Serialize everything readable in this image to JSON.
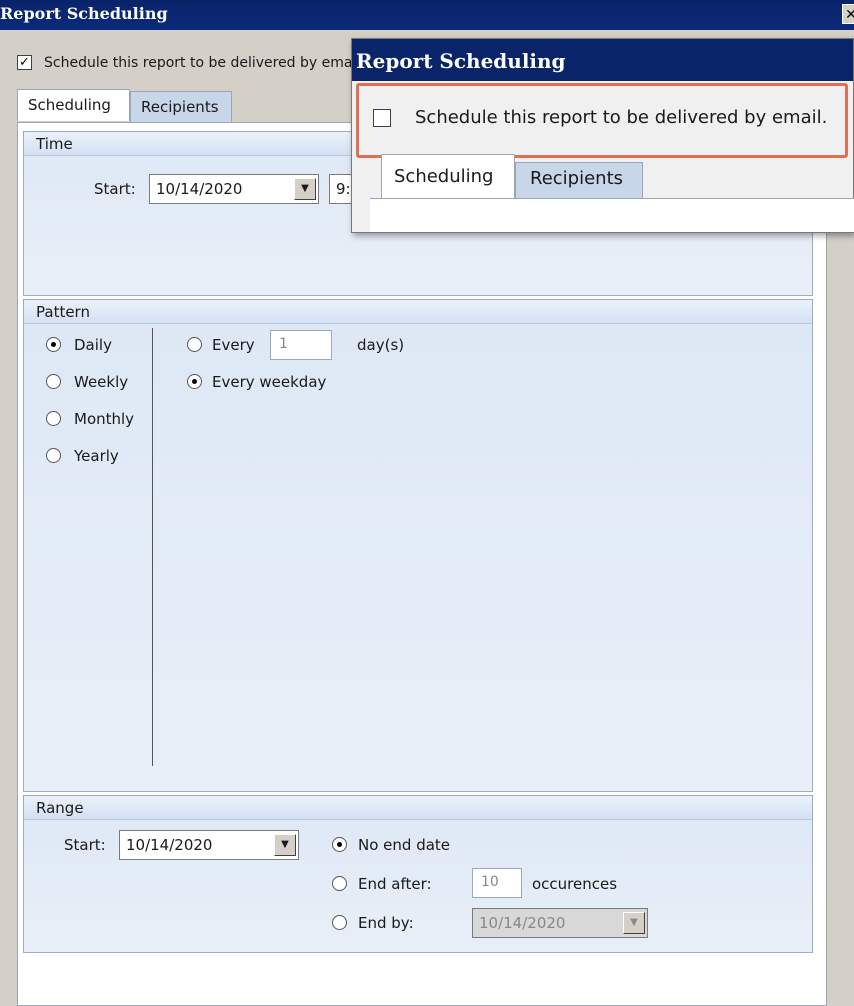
{
  "window": {
    "title": "Report Scheduling",
    "close_glyph": "✕"
  },
  "schedule_checkbox": {
    "label": "Schedule this report to be delivered by email.",
    "checked": true,
    "check_glyph": "✓"
  },
  "tabs": [
    {
      "label": "Scheduling",
      "active": true
    },
    {
      "label": "Recipients",
      "active": false
    }
  ],
  "time": {
    "heading": "Time",
    "start_label": "Start:",
    "start_date": "10/14/2020",
    "start_time": "9:"
  },
  "pattern": {
    "heading": "Pattern",
    "options": [
      {
        "label": "Daily",
        "selected": true
      },
      {
        "label": "Weekly",
        "selected": false
      },
      {
        "label": "Monthly",
        "selected": false
      },
      {
        "label": "Yearly",
        "selected": false
      }
    ],
    "every_label": "Every",
    "every_value": "1",
    "every_unit": "day(s)",
    "weekday_label": "Every weekday",
    "daily_mode": "every_weekday"
  },
  "range": {
    "heading": "Range",
    "start_label": "Start:",
    "start_date": "10/14/2020",
    "no_end_label": "No end date",
    "end_after_label": "End after:",
    "end_after_value": "10",
    "occurrences_label": "occurences",
    "end_by_label": "End by:",
    "end_by_date": "10/14/2020",
    "selected": "no_end_date"
  },
  "zoom_callout": {
    "title": "Report Scheduling",
    "checkbox_label": "Schedule this report to be delivered by email.",
    "checked": false,
    "tabs": [
      {
        "label": "Scheduling",
        "active": true
      },
      {
        "label": "Recipients",
        "active": false
      }
    ],
    "highlight_color": "#e0704f"
  },
  "icons": [
    "close-icon",
    "checkbox-icon",
    "dropdown-arrow-icon",
    "radio-icon"
  ],
  "colors": {
    "title_bar": "#0a246a",
    "panel": "#dde8f5",
    "highlight": "#e0704f"
  }
}
